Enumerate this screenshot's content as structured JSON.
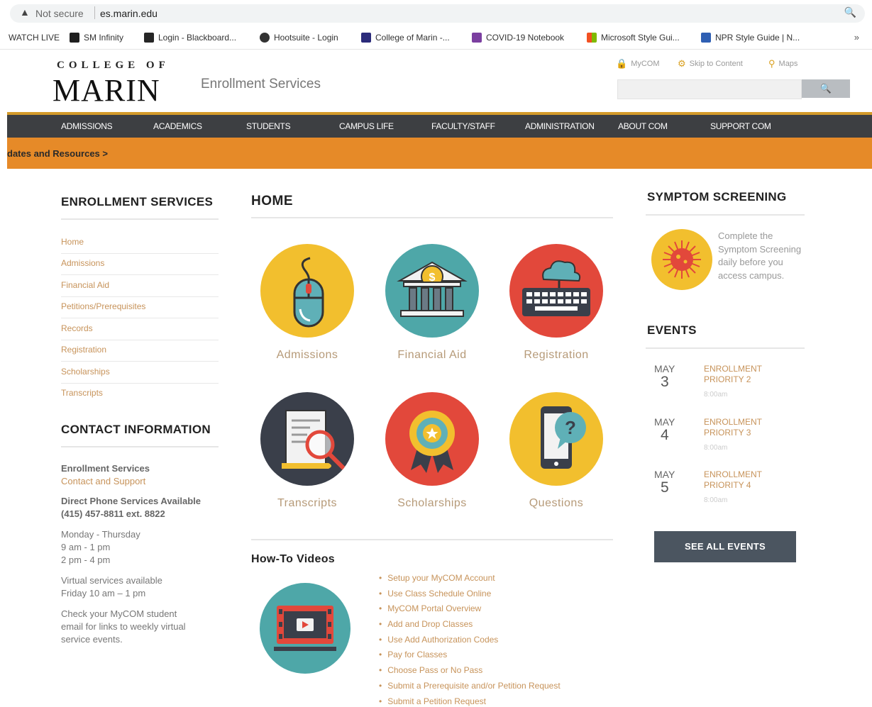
{
  "browser": {
    "security_label": "Not secure",
    "url": "es.marin.edu",
    "bookmarks": [
      {
        "label": "WATCH LIVE",
        "icon": "none",
        "color": ""
      },
      {
        "label": "SM Infinity",
        "icon": "sm-icon",
        "color": "#1f1f1f"
      },
      {
        "label": "Login - Blackboard...",
        "icon": "blackboard-icon",
        "color": "#262626"
      },
      {
        "label": "Hootsuite - Login",
        "icon": "hootsuite-icon",
        "color": "#333333"
      },
      {
        "label": "College of Marin -...",
        "icon": "marin-icon",
        "color": "#2b2b7a"
      },
      {
        "label": "COVID-19 Notebook",
        "icon": "onenote-icon",
        "color": "#7b3fa0"
      },
      {
        "label": "Microsoft Style Gui...",
        "icon": "microsoft-icon",
        "color": "#f25022"
      },
      {
        "label": "NPR Style Guide | N...",
        "icon": "npr-icon",
        "color": "#2f5fb3"
      }
    ],
    "more_label": "»"
  },
  "header": {
    "logo_top": "COLLEGE OF",
    "logo_main": "MARIN",
    "site_name": "Enrollment Services",
    "util_links": [
      {
        "label": "MyCOM",
        "icon": "lock-icon"
      },
      {
        "label": "Skip to Content",
        "icon": "gear-icon"
      },
      {
        "label": "Maps",
        "icon": "map-pin-icon"
      }
    ],
    "search_placeholder": "",
    "search_button": "🔍"
  },
  "nav": {
    "items": [
      "ADMISSIONS",
      "ACADEMICS",
      "STUDENTS",
      "CAMPUS LIFE",
      "FACULTY/STAFF",
      "ADMINISTRATION",
      "ABOUT COM",
      "SUPPORT COM"
    ]
  },
  "banner": {
    "text": "dates and Resources >"
  },
  "sidebar": {
    "heading": "ENROLLMENT SERVICES",
    "links": [
      "Home",
      "Admissions",
      "Financial Aid",
      "Petitions/Prerequisites",
      "Records",
      "Registration",
      "Scholarships",
      "Transcripts"
    ],
    "contact_heading": "CONTACT INFORMATION",
    "contact": {
      "org": "Enrollment Services",
      "contact_link": "Contact and Support",
      "phone_label": "Direct Phone Services Available",
      "phone": "(415) 457-8811 ext. 8822",
      "days": "Monday - Thursday",
      "hours1": "9 am - 1 pm",
      "hours2": "2 pm - 4 pm",
      "virtual1": "Virtual services available",
      "virtual2": "Friday 10 am – 1 pm",
      "check1": "Check your MyCOM student",
      "check2": "email for links to weekly virtual",
      "check3": "service events."
    }
  },
  "main": {
    "heading": "HOME",
    "tiles": [
      {
        "label": "Admissions",
        "icon": "mouse-icon",
        "color": "#f2bf2e"
      },
      {
        "label": "Financial Aid",
        "icon": "bank-icon",
        "color": "#4ea7a8"
      },
      {
        "label": "Registration",
        "icon": "keyboard-icon",
        "color": "#e2483b"
      },
      {
        "label": "Transcripts",
        "icon": "document-magnifier-icon",
        "color": "#3a3f4a"
      },
      {
        "label": "Scholarships",
        "icon": "award-ribbon-icon",
        "color": "#e2483b"
      },
      {
        "label": "Questions",
        "icon": "phone-question-icon",
        "color": "#f2bf2e"
      }
    ],
    "howto_heading": "How-To Videos",
    "videos": [
      "Setup your MyCOM Account",
      "Use Class Schedule Online",
      "MyCOM Portal Overview",
      "Add and Drop Classes",
      "Use Add Authorization Codes",
      "Pay for Classes",
      "Choose Pass or No Pass",
      "Submit a Prerequisite and/or Petition Request",
      "Submit a Petition Request"
    ]
  },
  "right": {
    "symptom_heading": "SYMPTOM SCREENING",
    "symptom_text": "Complete the Symptom Screening daily before you access campus.",
    "events_heading": "EVENTS",
    "events": [
      {
        "month": "MAY",
        "day": "3",
        "title": "ENROLLMENT PRIORITY 2",
        "time": "8:00am"
      },
      {
        "month": "MAY",
        "day": "4",
        "title": "ENROLLMENT PRIORITY 3",
        "time": "8:00am"
      },
      {
        "month": "MAY",
        "day": "5",
        "title": "ENROLLMENT PRIORITY 4",
        "time": "8:00am"
      }
    ],
    "see_all": "SEE ALL EVENTS"
  }
}
